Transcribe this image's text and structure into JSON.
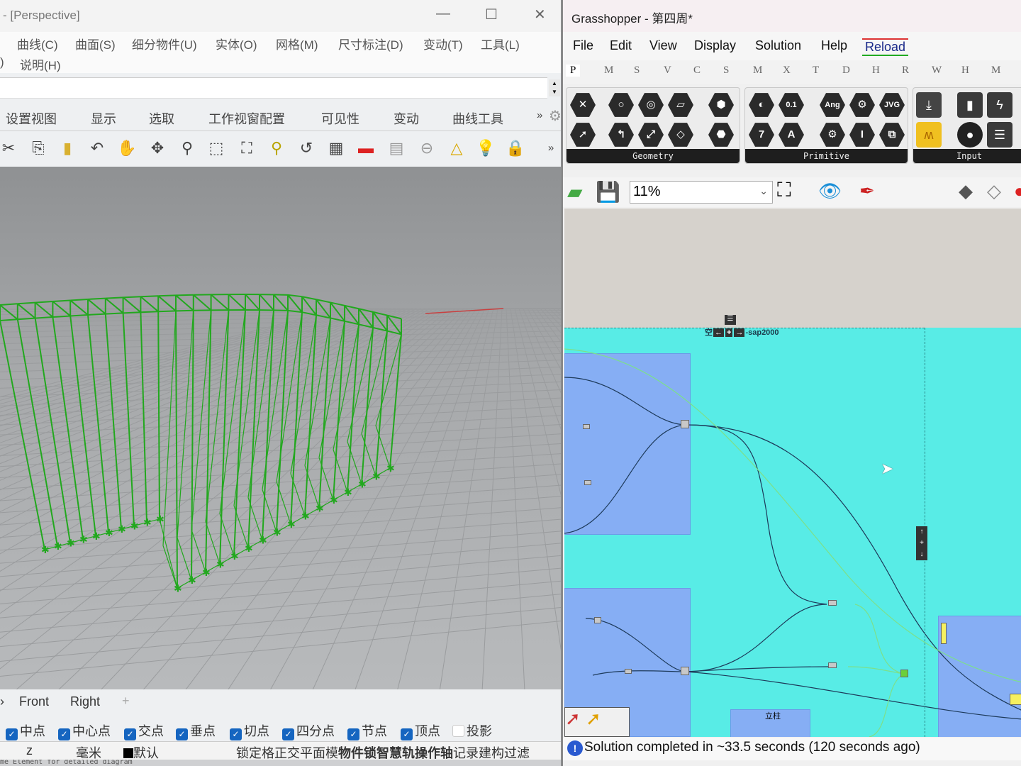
{
  "rhino": {
    "title": "- [Perspective]",
    "menu_row1": [
      "曲线(C)",
      "曲面(S)",
      "细分物件(U)",
      "实体(O)",
      "网格(M)",
      "尺寸标注(D)",
      "变动(T)",
      "工具(L)"
    ],
    "menu_row2": [
      ")",
      "说明(H)"
    ],
    "tabs": [
      "设置视图",
      "显示",
      "选取",
      "工作视窗配置",
      "可见性",
      "变动",
      "曲线工具"
    ],
    "tabs_more": "»",
    "toolbar_icons": [
      "cut-icon",
      "copy-icon",
      "paste-icon",
      "undo-icon",
      "pan-hand-icon",
      "rotate-view-icon",
      "zoom-in-out-icon",
      "zoom-window-icon",
      "zoom-extents-icon",
      "zoom-selected-icon",
      "undo-view-icon",
      "four-viewports-icon",
      "car-render-icon",
      "grid-icon",
      "osnap-icon",
      "shapes-icon",
      "light-icon",
      "lock-icon"
    ],
    "toolbar_more": "»",
    "viewport_tabs": [
      "Front",
      "Right"
    ],
    "viewport_add": "+",
    "osnaps": [
      {
        "label": "中点",
        "checked": true
      },
      {
        "label": "中心点",
        "checked": true
      },
      {
        "label": "交点",
        "checked": true
      },
      {
        "label": "垂点",
        "checked": true
      },
      {
        "label": "切点",
        "checked": true
      },
      {
        "label": "四分点",
        "checked": true
      },
      {
        "label": "节点",
        "checked": true
      },
      {
        "label": "顶点",
        "checked": true
      },
      {
        "label": "投影",
        "checked": false
      }
    ],
    "status": {
      "coord": "z",
      "units": "毫米",
      "layer": "默认",
      "toggles": [
        "锁定格",
        "正交",
        "平面模",
        "物件锁",
        "智慧轨",
        "操作轴",
        "记录建构",
        "过滤"
      ]
    },
    "bottom_strip": "me Element for detailed diagram",
    "model_color": "#22a81e"
  },
  "grasshopper": {
    "title": "Grasshopper - 第四周*",
    "menu": [
      "File",
      "Edit",
      "View",
      "Display",
      "Solution",
      "Help",
      "Reload"
    ],
    "tabs": [
      "P",
      "M",
      "S",
      "V",
      "C",
      "S",
      "M",
      "X",
      "T",
      "D",
      "H",
      "R",
      "W",
      "H",
      "M"
    ],
    "panels": [
      {
        "label": "Geometry"
      },
      {
        "label": "Primitive"
      },
      {
        "label": "Input"
      }
    ],
    "geometry_icons": [
      "point-icon",
      "circle-icon",
      "curve-icon",
      "surface-icon",
      "box-icon",
      "vector-icon",
      "arc-icon",
      "line-icon",
      "plane-icon",
      "brep-icon"
    ],
    "primitive_icons": [
      "boolean-icon",
      "number-icon",
      "integer-icon",
      "text-icon",
      "angle-icon",
      "settings-icon",
      "jvg-icon",
      "gear-icon",
      "data-icon",
      "box-3d-icon"
    ],
    "primitive_text": {
      "number": "0.1",
      "integer": "7",
      "text": "A",
      "angle": "Ang",
      "jvg": "JVG"
    },
    "zoom": "11%",
    "group_label": "sap2000",
    "group_prefix": "空",
    "sub_group_label": "立柱",
    "status": "Solution completed in ~33.5 seconds (120 seconds ago)",
    "canvas_color": "#58ece6",
    "group_color": "#86aef4"
  }
}
